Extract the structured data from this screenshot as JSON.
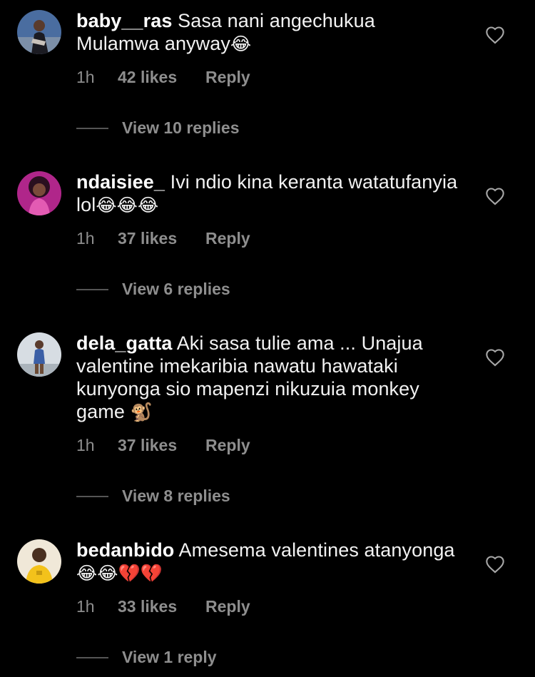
{
  "comments": [
    {
      "username": "baby__ras",
      "text": "Sasa nani angechukua Mulamwa anyway",
      "emojis": "😂",
      "time": "1h",
      "likes": "42 likes",
      "reply": "Reply",
      "view_replies": "View 10 replies",
      "avatar_colors": [
        "#4a6da0",
        "#c9c2bb",
        "#1b1b22"
      ]
    },
    {
      "username": "ndaisiee_",
      "text": "Ivi ndio kina keranta watatufanyia lol",
      "emojis": "😂😂😂",
      "time": "1h",
      "likes": "37 likes",
      "reply": "Reply",
      "view_replies": "View 6 replies",
      "avatar_colors": [
        "#b0268a",
        "#e35bb3",
        "#2a0f1f"
      ]
    },
    {
      "username": "dela_gatta",
      "text": "Aki sasa tulie ama ... Unajua valentine imekaribia nawatu hawataki kunyonga sio mapenzi nikuzuia monkey game",
      "emojis": "🐒",
      "time": "1h",
      "likes": "37 likes",
      "reply": "Reply",
      "view_replies": "View 8 replies",
      "avatar_colors": [
        "#d7dde3",
        "#3b5fa6",
        "#6b4a35"
      ]
    },
    {
      "username": "bedanbido",
      "text": "Amesema valentines atanyonga",
      "emojis": "😂😂💔💔",
      "time": "1h",
      "likes": "33 likes",
      "reply": "Reply",
      "view_replies": "View 1 reply",
      "avatar_colors": [
        "#f0e8d8",
        "#f3c21b",
        "#4a3020"
      ]
    }
  ],
  "colors": {
    "background": "#000000",
    "text": "#ffffff",
    "muted": "#8e8e8e"
  }
}
